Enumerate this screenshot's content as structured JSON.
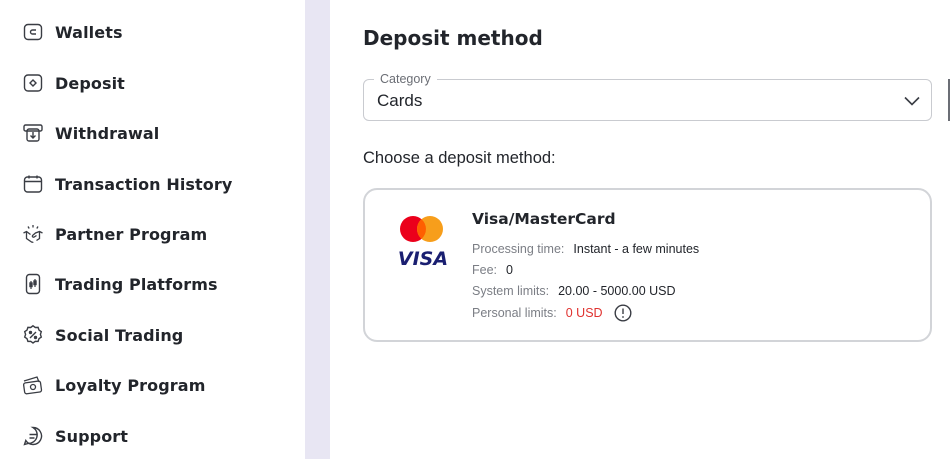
{
  "sidebar": {
    "items": [
      {
        "label": "Wallets",
        "icon": "wallet-icon"
      },
      {
        "label": "Deposit",
        "icon": "deposit-icon"
      },
      {
        "label": "Withdrawal",
        "icon": "withdrawal-icon"
      },
      {
        "label": "Transaction History",
        "icon": "calendar-icon"
      },
      {
        "label": "Partner Program",
        "icon": "handshake-icon"
      },
      {
        "label": "Trading Platforms",
        "icon": "trading-phone-icon"
      },
      {
        "label": "Social Trading",
        "icon": "percent-badge-icon"
      },
      {
        "label": "Loyalty Program",
        "icon": "cash-icon"
      },
      {
        "label": "Support",
        "icon": "chat-icon"
      }
    ]
  },
  "main": {
    "title": "Deposit method",
    "category": {
      "legend": "Category",
      "value": "Cards"
    },
    "choose_label": "Choose a deposit method:",
    "method": {
      "name": "Visa/MasterCard",
      "logo_text": "VISA",
      "processing_time_label": "Processing time:",
      "processing_time_value": "Instant - a few minutes",
      "fee_label": "Fee:",
      "fee_value": "0",
      "system_limits_label": "System limits:",
      "system_limits_value": "20.00 - 5000.00 USD",
      "personal_limits_label": "Personal limits:",
      "personal_limits_value": "0 USD"
    }
  },
  "colors": {
    "accent_band": "#e8e6f3",
    "limit_red": "#e0322f",
    "mastercard_red": "#eb001b",
    "mastercard_orange": "#f79e1b",
    "visa_blue": "#1a1f71"
  }
}
